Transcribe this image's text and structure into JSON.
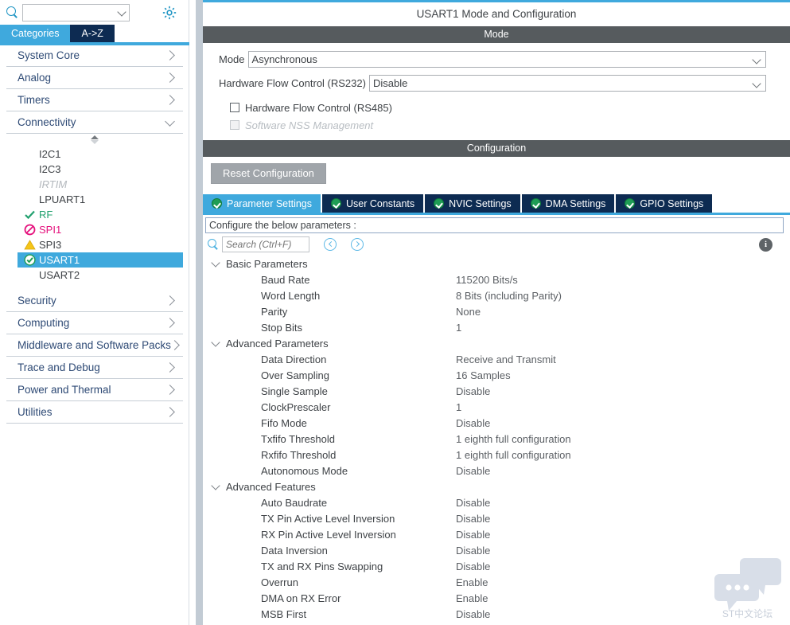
{
  "left_panel": {
    "search": {
      "value": "",
      "placeholder": ""
    },
    "gear_icon": "gear-icon",
    "tabs": [
      {
        "label": "Categories",
        "active": true
      },
      {
        "label": "A->Z",
        "active": false
      }
    ],
    "categories": [
      {
        "label": "System Core",
        "expanded": false
      },
      {
        "label": "Analog",
        "expanded": false
      },
      {
        "label": "Timers",
        "expanded": false
      },
      {
        "label": "Connectivity",
        "expanded": true
      }
    ],
    "peripherals": [
      {
        "label": "I2C1",
        "state": "none"
      },
      {
        "label": "I2C3",
        "state": "none"
      },
      {
        "label": "IRTIM",
        "state": "disabled"
      },
      {
        "label": "LPUART1",
        "state": "none"
      },
      {
        "label": "RF",
        "state": "check"
      },
      {
        "label": "SPI1",
        "state": "forbidden"
      },
      {
        "label": "SPI3",
        "state": "warning"
      },
      {
        "label": "USART1",
        "state": "selected"
      },
      {
        "label": "USART2",
        "state": "none"
      }
    ],
    "categories_bottom": [
      {
        "label": "Security",
        "expanded": false
      },
      {
        "label": "Computing",
        "expanded": false
      },
      {
        "label": "Middleware and Software Packs",
        "expanded": false
      },
      {
        "label": "Trace and Debug",
        "expanded": false
      },
      {
        "label": "Power and Thermal",
        "expanded": false
      },
      {
        "label": "Utilities",
        "expanded": false
      }
    ]
  },
  "right_panel": {
    "title": "USART1 Mode and Configuration",
    "mode_section": {
      "header": "Mode",
      "mode_label": "Mode",
      "mode_value": "Asynchronous",
      "hw_flow_label": "Hardware Flow Control (RS232)",
      "hw_flow_value": "Disable",
      "checkboxes": [
        {
          "label": "Hardware Flow Control (RS485)",
          "checked": false,
          "disabled": false
        },
        {
          "label": "Software NSS Management",
          "checked": false,
          "disabled": true
        }
      ]
    },
    "config_section": {
      "header": "Configuration",
      "reset_button": "Reset Configuration",
      "tabs": [
        {
          "label": "Parameter Settings",
          "active": true
        },
        {
          "label": "User Constants",
          "active": false
        },
        {
          "label": "NVIC Settings",
          "active": false
        },
        {
          "label": "DMA Settings",
          "active": false
        },
        {
          "label": "GPIO Settings",
          "active": false
        }
      ],
      "configure_label": "Configure the below parameters :",
      "search": {
        "value": "",
        "placeholder": "Search (Ctrl+F)"
      },
      "prev_button": "prev-icon",
      "next_button": "next-icon",
      "info_button": "i",
      "groups": [
        {
          "label": "Basic Parameters",
          "expanded": true,
          "rows": [
            {
              "name": "Baud Rate",
              "value": "115200 Bits/s"
            },
            {
              "name": "Word Length",
              "value": "8 Bits (including Parity)"
            },
            {
              "name": "Parity",
              "value": "None"
            },
            {
              "name": "Stop Bits",
              "value": "1"
            }
          ]
        },
        {
          "label": "Advanced Parameters",
          "expanded": true,
          "rows": [
            {
              "name": "Data Direction",
              "value": "Receive and Transmit"
            },
            {
              "name": "Over Sampling",
              "value": "16 Samples"
            },
            {
              "name": "Single Sample",
              "value": "Disable"
            },
            {
              "name": "ClockPrescaler",
              "value": "1"
            },
            {
              "name": "Fifo Mode",
              "value": "Disable"
            },
            {
              "name": "Txfifo Threshold",
              "value": "1 eighth full configuration"
            },
            {
              "name": "Rxfifo Threshold",
              "value": "1 eighth full configuration"
            },
            {
              "name": "Autonomous Mode",
              "value": "Disable"
            }
          ]
        },
        {
          "label": "Advanced Features",
          "expanded": true,
          "rows": [
            {
              "name": "Auto Baudrate",
              "value": "Disable"
            },
            {
              "name": "TX Pin Active Level Inversion",
              "value": "Disable"
            },
            {
              "name": "RX Pin Active Level Inversion",
              "value": "Disable"
            },
            {
              "name": "Data Inversion",
              "value": "Disable"
            },
            {
              "name": "TX and RX Pins Swapping",
              "value": "Disable"
            },
            {
              "name": "Overrun",
              "value": "Enable"
            },
            {
              "name": "DMA on RX Error",
              "value": "Enable"
            },
            {
              "name": "MSB First",
              "value": "Disable"
            }
          ]
        }
      ]
    }
  },
  "watermark": {
    "text": "ST中文论坛"
  },
  "colors": {
    "accent": "#3fa9dd",
    "tab_dark": "#0d2b52",
    "section_bar": "#565b5e",
    "category_text": "#2e4a75",
    "check_green": "#1f9d55",
    "forbidden_pink": "#e5127d",
    "warning_yellow": "#f5c518"
  }
}
